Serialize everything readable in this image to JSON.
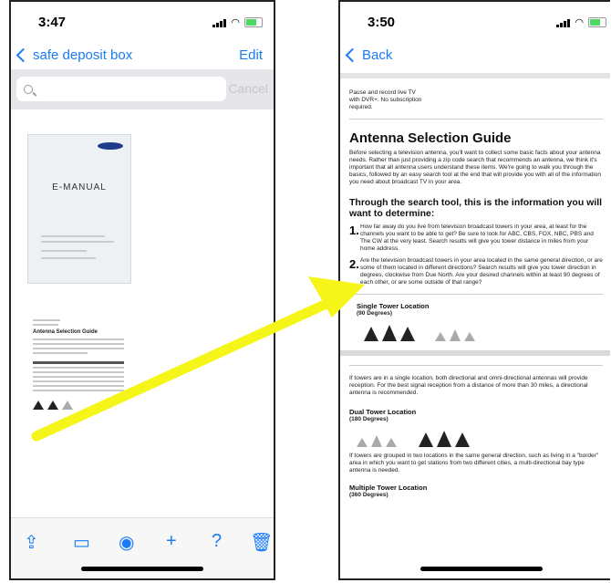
{
  "left": {
    "time": "3:47",
    "nav": {
      "back_label": "safe deposit box",
      "edit_label": "Edit"
    },
    "search": {
      "placeholder": "",
      "cancel_label": "Cancel"
    },
    "manual": {
      "title": "E-MANUAL"
    },
    "page2": {
      "title": "Antenna Selection Guide"
    }
  },
  "right": {
    "time": "3:50",
    "nav": {
      "back_label": "Back"
    },
    "intro": "Pause and record live TV with DVR+. No subscription required.",
    "heading": "Antenna Selection Guide",
    "para1": "Before selecting a television antenna, you'll want to collect some basic facts about your antenna needs. Rather than just providing a zip code search that recommends an antenna, we think it's important that all antenna users understand these items. We're going to walk you through the basics, followed by an easy search tool at the end that will provide you with all of the information you need about broadcast TV in your area.",
    "subheading": "Through the search tool, this is the information you will want to determine:",
    "items": [
      {
        "num": "1.",
        "text": "How far away do you live from television broadcast towers in your area, at least for the channels you want to be able to get? Be sure to look for ABC, CBS, FOX, NBC, PBS and The CW at the very least. Search results will give you tower distance in miles from your home address."
      },
      {
        "num": "2.",
        "text": "Are the television broadcast towers in your area located in the same general direction, or are some of them located in different directions? Search results will give you tower direction in degrees, clockwise from Due North. Are your desired channels within at least 90 degrees of each other, or are some outside of that range?"
      }
    ],
    "single": {
      "title": "Single Tower Location",
      "sub": "(90 Degrees)"
    },
    "para2": "If towers are in a single location, both directional and omni-directional antennas will provide reception. For the best signal reception from a distance of more than 30 miles, a directional antenna is recommended.",
    "dual": {
      "title": "Dual Tower Location",
      "sub": "(180 Degrees)"
    },
    "para3": "If towers are grouped in two locations in the same general direction, such as living in a \"border\" area in which you want to get stations from two different cities, a multi-directional bay type antenna is needed.",
    "multi": {
      "title": "Multiple Tower Location",
      "sub": "(360 Degrees)"
    }
  },
  "colors": {
    "accent": "#1a7cf5",
    "arrow": "#f5f519"
  }
}
